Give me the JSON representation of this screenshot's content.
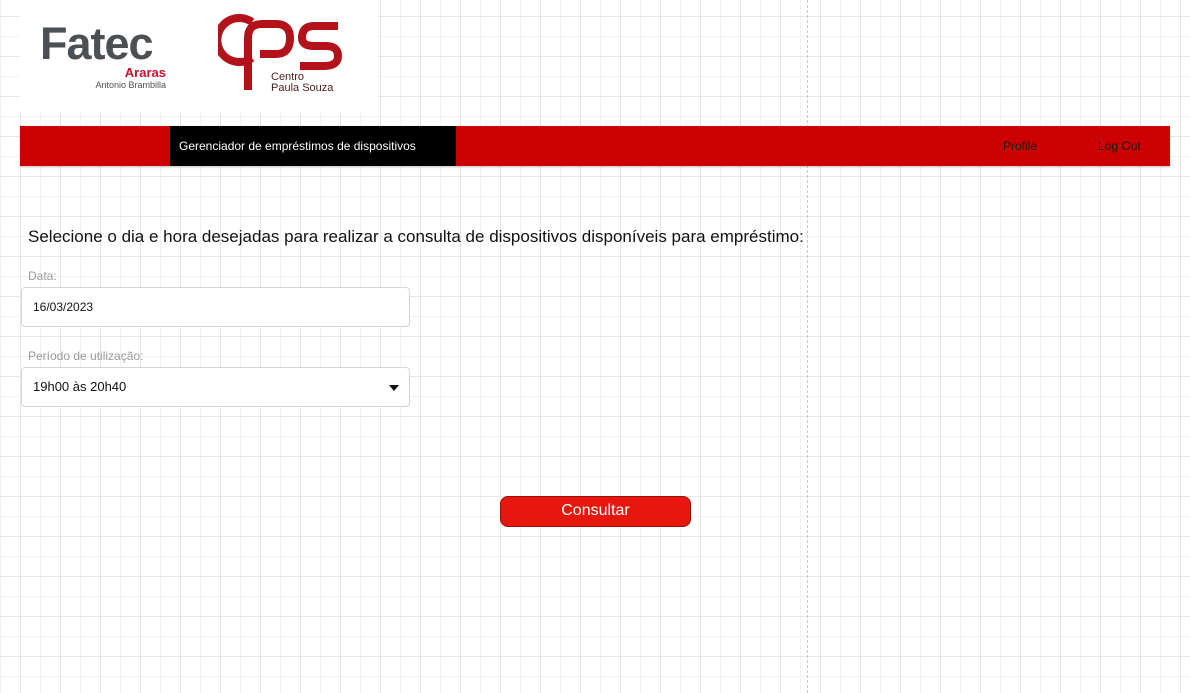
{
  "logos": {
    "fatec": {
      "name": "Fatec",
      "city": "Araras",
      "unit": "Antonio Brambilla"
    },
    "cps": {
      "mark": "cps",
      "line1": "Centro",
      "line2": "Paula Souza",
      "color": "#b3121b"
    }
  },
  "navbar": {
    "brand": "Gerenciador de empréstimos de dispositivos",
    "links": [
      "Profile",
      "Log Out"
    ],
    "background": "#cc0000"
  },
  "form": {
    "instructions": "Selecione o dia e hora desejadas para realizar a consulta de dispositivos disponíveis para empréstimo:",
    "date_label": "Data:",
    "date_value": "16/03/2023",
    "period_label": "Período de utilização:",
    "period_value": "19h00 às 20h40",
    "period_icon": "caret-down-icon",
    "submit_label": "Consultar",
    "submit_color": "#e8170d"
  }
}
